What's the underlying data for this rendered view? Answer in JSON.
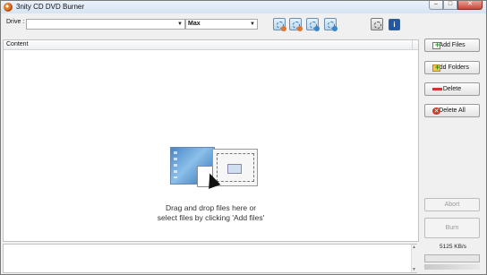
{
  "window": {
    "title": "3nity CD DVD Burner"
  },
  "toolbar": {
    "drive_label": "Drive :",
    "drive_value": "",
    "speed_value": "Max",
    "tools": [
      "burn-data-icon",
      "burn-audio-icon",
      "burn-video-icon",
      "burn-image-icon",
      "settings-icon",
      "info-icon"
    ]
  },
  "content": {
    "header": "Content",
    "drop_line1": "Drag and drop files here or",
    "drop_line2": "select files by clicking 'Add files'"
  },
  "buttons": {
    "add_files": "Add Files",
    "add_folders": "Add Folders",
    "delete": "Delete",
    "delete_all": "Delete All",
    "abort": "Abort",
    "burn": "Burn"
  },
  "status": {
    "speed": "5125 KB/s",
    "progress": 0
  },
  "colors": {
    "accent": "#1f58a8",
    "delete_red": "#d4352b",
    "add_green": "#2c9a2c"
  }
}
